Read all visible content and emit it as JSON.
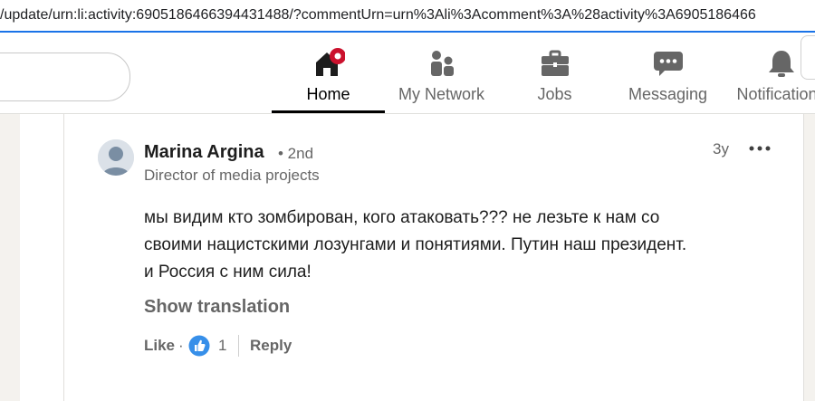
{
  "browser": {
    "url": "/update/urn:li:activity:6905186466394431488/?commentUrn=urn%3Ali%3Acomment%3A%28activity%3A6905186466"
  },
  "nav": {
    "items": [
      {
        "label": "Home",
        "icon": "home-icon",
        "active": true,
        "notification": true
      },
      {
        "label": "My Network",
        "icon": "people-icon"
      },
      {
        "label": "Jobs",
        "icon": "briefcase-icon"
      },
      {
        "label": "Messaging",
        "icon": "message-icon"
      },
      {
        "label": "Notifications",
        "icon": "bell-icon"
      }
    ]
  },
  "comment": {
    "author": "Marina Argina",
    "degree": "• 2nd",
    "headline": "Director of media projects",
    "time": "3y",
    "text_lines": [
      "мы видим кто зомбирован, кого атаковать??? не лезьте к нам со",
      "своими нацистскими лозунгами и понятиями. Путин наш президент.",
      "и Россия с ним сила!"
    ],
    "show_translation": "Show translation",
    "like_label": "Like",
    "dot": "·",
    "like_count": "1",
    "reply_label": "Reply"
  },
  "colors": {
    "accent": "#0a66c2",
    "notification": "#cb112d",
    "text": "#1d1d1d",
    "muted": "#666666"
  }
}
